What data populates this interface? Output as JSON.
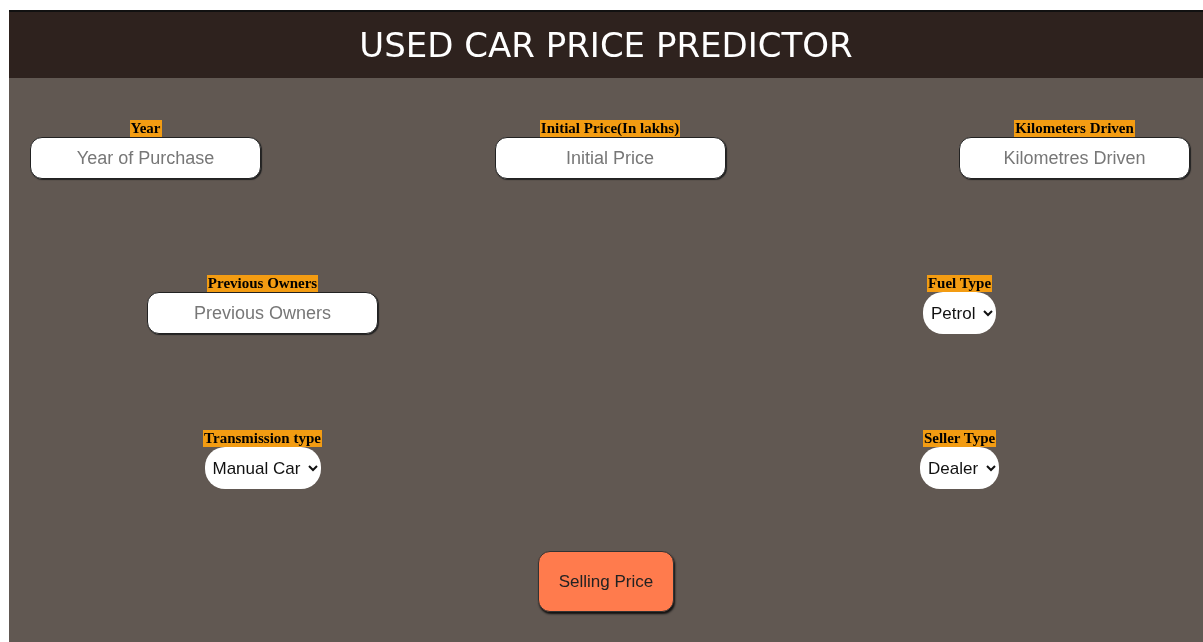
{
  "header": {
    "title": "USED CAR PRICE PREDICTOR"
  },
  "rows": [
    {
      "fields": [
        {
          "kind": "input",
          "label": "Year",
          "placeholder": "Year of Purchase"
        },
        {
          "kind": "input",
          "label": "Initial Price(In lakhs)",
          "placeholder": "Initial Price"
        },
        {
          "kind": "input",
          "label": "Kilometers Driven",
          "placeholder": "Kilometres Driven"
        }
      ]
    },
    {
      "fields": [
        {
          "kind": "input",
          "label": "Previous Owners",
          "placeholder": "Previous Owners"
        },
        {
          "kind": "select",
          "label": "Fuel Type",
          "value": "Petrol"
        }
      ]
    },
    {
      "fields": [
        {
          "kind": "select",
          "label": "Transmission type",
          "value": "Manual Car"
        },
        {
          "kind": "select",
          "label": "Seller Type",
          "value": "Dealer"
        }
      ]
    }
  ],
  "button": {
    "label": "Selling Price"
  }
}
